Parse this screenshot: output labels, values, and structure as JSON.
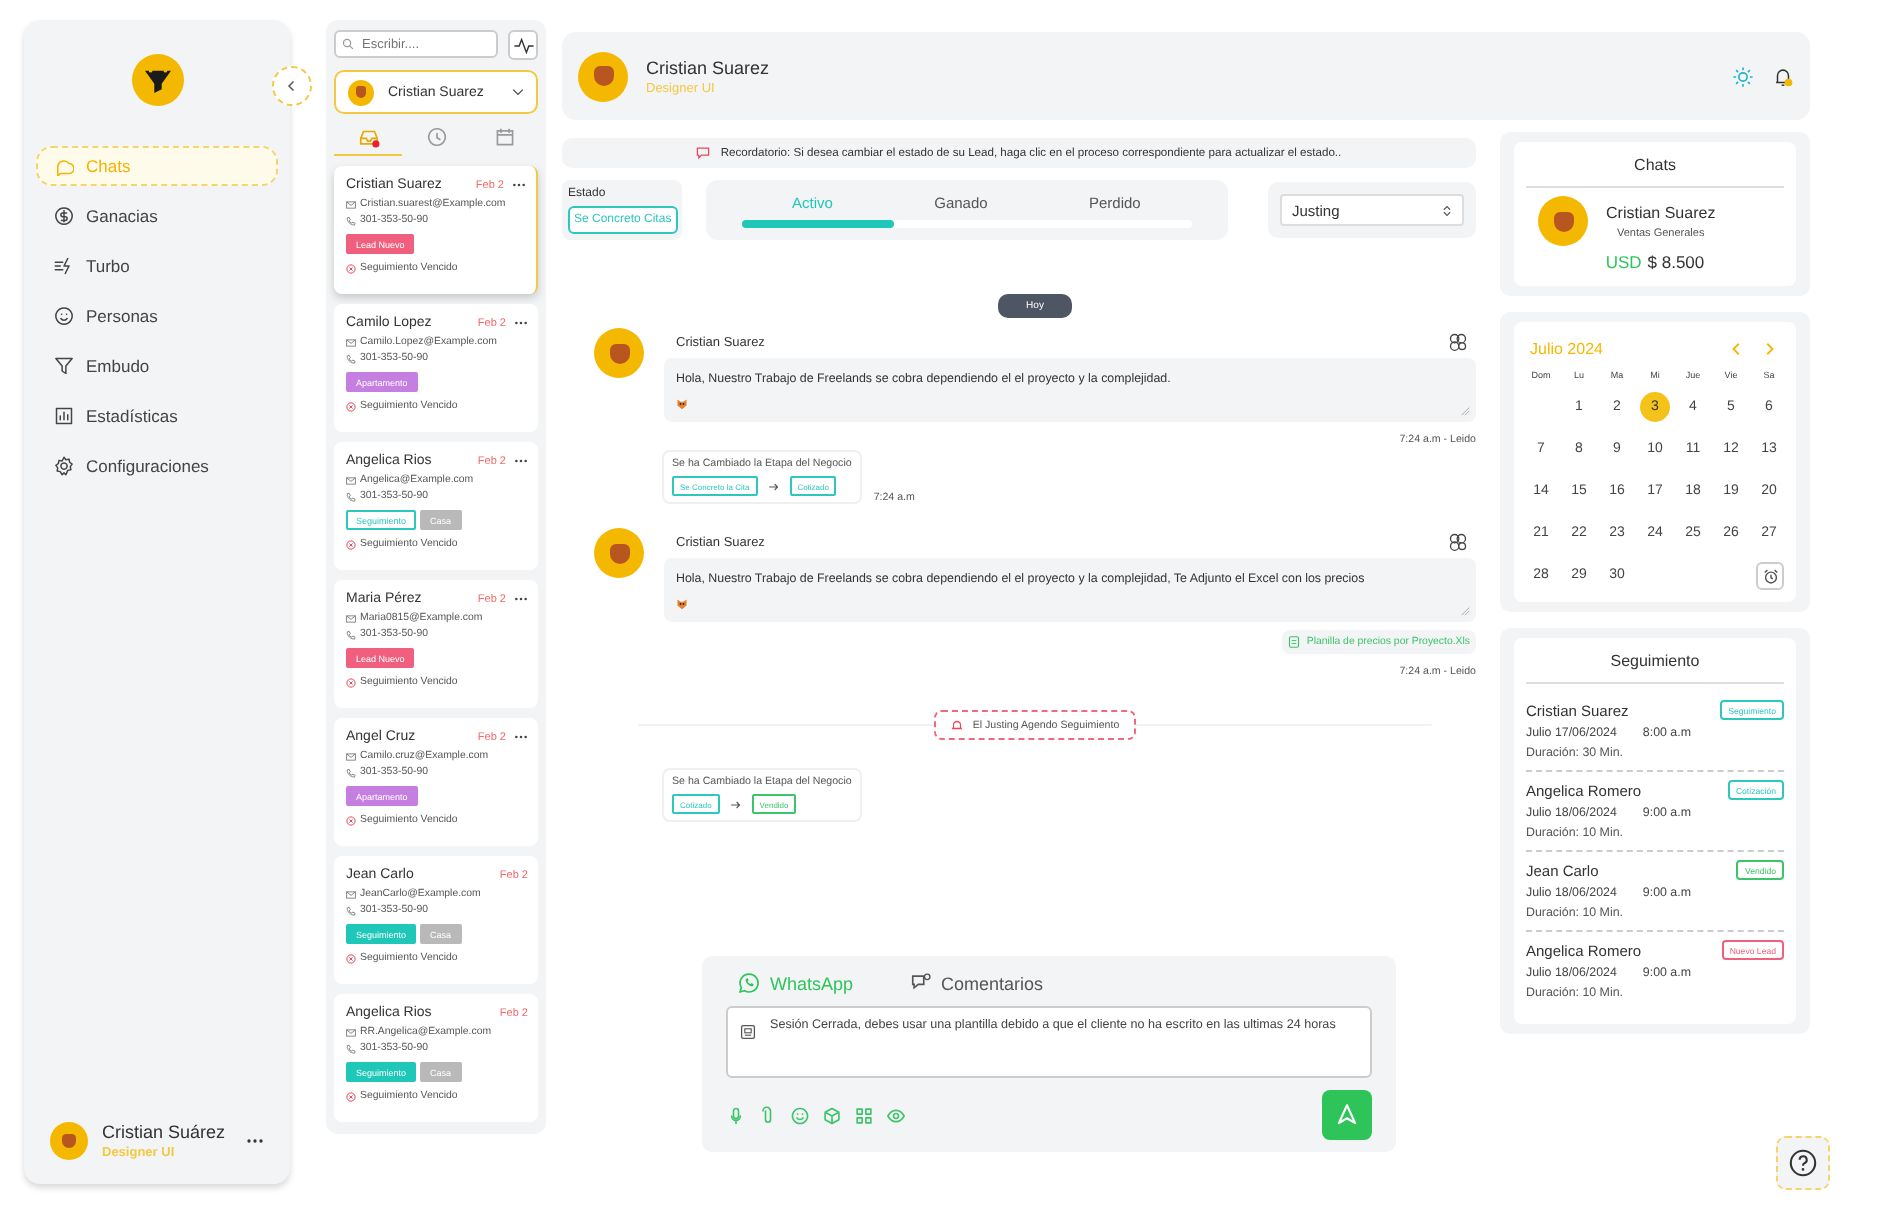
{
  "sidebar": {
    "items": [
      {
        "label": "Chats",
        "selected": true
      },
      {
        "label": "Ganacias",
        "selected": false
      },
      {
        "label": "Turbo",
        "selected": false
      },
      {
        "label": "Personas",
        "selected": false
      },
      {
        "label": "Embudo",
        "selected": false
      },
      {
        "label": "Estadísticas",
        "selected": false
      },
      {
        "label": "Configuraciones",
        "selected": false
      }
    ],
    "user": {
      "name": "Cristian Suárez",
      "role": "Designer UI"
    }
  },
  "contacts": {
    "search": {
      "placeholder": "Escribir...."
    },
    "agent": "Cristian Suarez",
    "tabs": [
      {
        "selected": true
      },
      {
        "selected": false
      },
      {
        "selected": false
      }
    ],
    "list": [
      {
        "name": "Cristian Suarez",
        "date": "Feb 2",
        "menu": true,
        "email": "Cristian.suarest@Example.com",
        "phone": "301-353-50-90",
        "tags": [
          {
            "label": "Lead Nuevo",
            "kind": "filled",
            "color": "#f0607e"
          }
        ],
        "followup": "Seguimiento Vencido",
        "selected": true
      },
      {
        "name": "Camilo Lopez",
        "date": "Feb 2",
        "menu": true,
        "email": "Camilo.Lopez@Example.com",
        "phone": "301-353-50-90",
        "tags": [
          {
            "label": "Apartamento",
            "kind": "filled",
            "color": "#c47fe0"
          }
        ],
        "followup": "Seguimiento Vencido",
        "selected": false
      },
      {
        "name": "Angelica Rios",
        "date": "Feb 2",
        "menu": true,
        "email": "Angelica@Example.com",
        "phone": "301-353-50-90",
        "tags": [
          {
            "label": "Seguimiento",
            "kind": "outline",
            "color": "#2cc7bd"
          },
          {
            "label": "Casa",
            "kind": "filled",
            "color": "#b9b9b9"
          }
        ],
        "followup": "Seguimiento Vencido",
        "selected": false
      },
      {
        "name": "Maria Pérez",
        "date": "Feb 2",
        "menu": true,
        "email": "Maria0815@Example.com",
        "phone": "301-353-50-90",
        "tags": [
          {
            "label": "Lead Nuevo",
            "kind": "filled",
            "color": "#f0607e"
          }
        ],
        "followup": "Seguimiento Vencido",
        "selected": false
      },
      {
        "name": "Angel Cruz",
        "date": "Feb 2",
        "menu": true,
        "email": "Camilo.cruz@Example.com",
        "phone": "301-353-50-90",
        "tags": [
          {
            "label": "Apartamento",
            "kind": "filled",
            "color": "#c47fe0"
          }
        ],
        "followup": "Seguimiento Vencido",
        "selected": false
      },
      {
        "name": "Jean Carlo",
        "date": "Feb 2",
        "menu": false,
        "email": "JeanCarlo@Example.com",
        "phone": "301-353-50-90",
        "tags": [
          {
            "label": "Seguimiento",
            "kind": "filled",
            "color": "#1fc7b8"
          },
          {
            "label": "Casa",
            "kind": "filled",
            "color": "#b9b9b9"
          }
        ],
        "followup": "Seguimiento Vencido",
        "selected": false
      },
      {
        "name": "Angelica Rios",
        "date": "Feb 2",
        "menu": false,
        "email": "RR.Angelica@Example.com",
        "phone": "301-353-50-90",
        "tags": [
          {
            "label": "Seguimiento",
            "kind": "filled",
            "color": "#1fc7b8"
          },
          {
            "label": "Casa",
            "kind": "filled",
            "color": "#b9b9b9"
          }
        ],
        "followup": "Seguimiento Vencido",
        "selected": false
      }
    ]
  },
  "header": {
    "name": "Cristian Suarez",
    "role": "Designer UI"
  },
  "reminder": "Recordatorio: Si desea cambiar el estado de su Lead, haga clic en el proceso correspondiente para actualizar el estado..",
  "estado": {
    "label": "Estado",
    "value": "Se Concreto Citas"
  },
  "stages": {
    "tabs": [
      {
        "label": "Activo",
        "selected": true
      },
      {
        "label": "Ganado",
        "selected": false
      },
      {
        "label": "Perdido",
        "selected": false
      }
    ],
    "level": 0.34
  },
  "assignee": "Justing",
  "chat": [
    {
      "kind": "date",
      "text": "Hoy"
    },
    {
      "kind": "message",
      "author": "Cristian Suarez",
      "text": "Hola, Nuestro Trabajo de Freelands se cobra dependiendo el el proyecto y la complejidad.",
      "time": "7:24 a.m - Leido"
    },
    {
      "kind": "stage_change",
      "title": "Se ha Cambiado la Etapa del Negocio",
      "from": {
        "label": "Se Concreto la Cita",
        "color": "#2cc7bd"
      },
      "to": {
        "label": "Cotizado",
        "color": "#2cc7bd"
      },
      "time": "7:24 a.m"
    },
    {
      "kind": "message",
      "author": "Cristian Suarez",
      "text": "Hola, Nuestro Trabajo de Freelands se cobra dependiendo el el proyecto y la complejidad, Te Adjunto el Excel con los precios",
      "attachment": "Planilla de precios por Proyecto.Xls",
      "time": "7:24 a.m - Leido"
    },
    {
      "kind": "event",
      "text": "El Justing Agendo Seguimiento"
    },
    {
      "kind": "stage_change",
      "title": "Se ha Cambiado la Etapa del Negocio",
      "from": {
        "label": "Cotizado",
        "color": "#2cc7bd"
      },
      "to": {
        "label": "Vendido",
        "color": "#3cc46a"
      }
    }
  ],
  "composer": {
    "tabs": [
      {
        "label": "WhatsApp",
        "selected": true
      },
      {
        "label": "Comentarios",
        "selected": false
      }
    ],
    "message": "Sesión Cerrada, debes usar una plantilla debido a que el cliente no ha escrito en las ultimas 24 horas"
  },
  "chats_card": {
    "title": "Chats",
    "name": "Cristian Suarez",
    "department": "Ventas Generales",
    "currency": "USD",
    "amount": "$ 8.500"
  },
  "calendar": {
    "month": "Julio 2024",
    "weekdays": [
      "Dom",
      "Lu",
      "Ma",
      "Mi",
      "Jue",
      "Vie",
      "Sa"
    ],
    "weeks": [
      [
        {
          "day": "1",
          "selected": false
        },
        {
          "day": "2",
          "selected": false
        },
        {
          "day": "3",
          "selected": true
        },
        {
          "day": "4",
          "selected": false
        },
        {
          "day": "5",
          "selected": false
        },
        {
          "day": "6",
          "selected": false
        }
      ],
      [
        {
          "day": "7",
          "selected": false
        },
        {
          "day": "8",
          "selected": false
        },
        {
          "day": "9",
          "selected": false
        },
        {
          "day": "10",
          "selected": false
        },
        {
          "day": "11",
          "selected": false
        },
        {
          "day": "12",
          "selected": false
        },
        {
          "day": "13",
          "selected": false
        }
      ],
      [
        {
          "day": "14",
          "selected": false
        },
        {
          "day": "15",
          "selected": false
        },
        {
          "day": "16",
          "selected": false
        },
        {
          "day": "17",
          "selected": false
        },
        {
          "day": "18",
          "selected": false
        },
        {
          "day": "19",
          "selected": false
        },
        {
          "day": "20",
          "selected": false
        }
      ],
      [
        {
          "day": "21",
          "selected": false
        },
        {
          "day": "22",
          "selected": false
        },
        {
          "day": "23",
          "selected": false
        },
        {
          "day": "24",
          "selected": false
        },
        {
          "day": "25",
          "selected": false
        },
        {
          "day": "26",
          "selected": false
        },
        {
          "day": "27",
          "selected": false
        }
      ],
      [
        {
          "day": "28",
          "selected": false
        },
        {
          "day": "29",
          "selected": false
        },
        {
          "day": "30",
          "selected": false
        }
      ]
    ]
  },
  "followups": {
    "title": "Seguimiento",
    "items": [
      {
        "name": "Cristian Suarez",
        "date": "Julio 17/06/2024",
        "time": "8:00 a.m",
        "duration": "Duración: 30 Min.",
        "tag": {
          "label": "Seguimiento",
          "color": "#2cc7bd"
        }
      },
      {
        "name": "Angelica Romero",
        "date": "Julio 18/06/2024",
        "time": "9:00 a.m",
        "duration": "Duración: 10 Min.",
        "tag": {
          "label": "Cotización",
          "color": "#2cc7bd"
        }
      },
      {
        "name": "Jean Carlo",
        "date": "Julio 18/06/2024",
        "time": "9:00 a.m",
        "duration": "Duración: 10 Min.",
        "tag": {
          "label": "Vendido",
          "color": "#3cc46a"
        }
      },
      {
        "name": "Angelica Romero",
        "date": "Julio 18/06/2024",
        "time": "9:00 a.m",
        "duration": "Duración: 10 Min.",
        "tag": {
          "label": "Nuevo Lead",
          "color": "#f0607e"
        }
      }
    ]
  }
}
